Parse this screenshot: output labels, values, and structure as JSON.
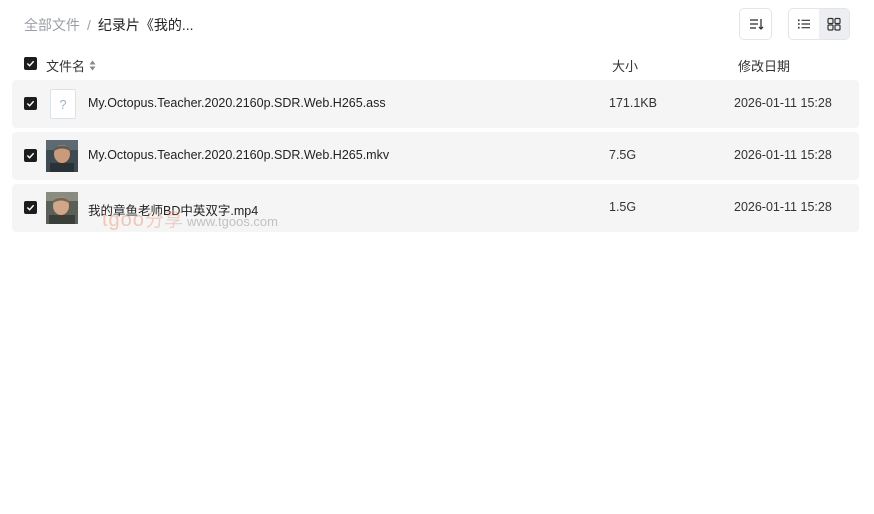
{
  "breadcrumb": {
    "root": "全部文件",
    "separator": "/",
    "current": "纪录片《我的..."
  },
  "toolbar": {
    "sort_icon": "sort-lines-icon",
    "list_icon": "list-view-icon",
    "grid_icon": "grid-view-icon",
    "active_view": "grid"
  },
  "columns": {
    "name": "文件名",
    "size": "大小",
    "date": "修改日期"
  },
  "files": [
    {
      "name": "My.Octopus.Teacher.2020.2160p.SDR.Web.H265.ass",
      "size": "171.1KB",
      "date": "2026-01-11 15:28",
      "thumbnail": "unknown-file-icon",
      "checked": true
    },
    {
      "name": "My.Octopus.Teacher.2020.2160p.SDR.Web.H265.mkv",
      "size": "7.5G",
      "date": "2026-01-11 15:28",
      "thumbnail": "video-thumbnail",
      "checked": true
    },
    {
      "name": "我的章鱼老师BD中英双字.mp4",
      "size": "1.5G",
      "date": "2026-01-11 15:28",
      "thumbnail": "video-thumbnail",
      "checked": true
    }
  ],
  "watermark": {
    "logo": "tgoo",
    "cn": "分享",
    "url": "www.tgoos.com"
  },
  "colors": {
    "row_bg": "#f5f5f6",
    "check_bg": "#1c1c1c",
    "watermark": "#e8a082"
  }
}
